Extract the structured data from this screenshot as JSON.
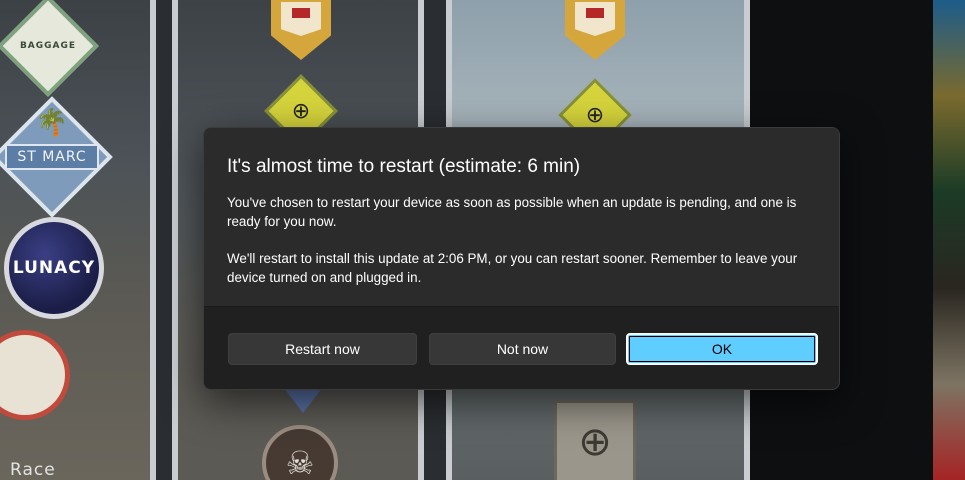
{
  "background": {
    "badges": {
      "baggage": "BAGGAGE",
      "st_marc": "ST MARC",
      "lunacy": "LUNACY",
      "race": "Race"
    }
  },
  "dialog": {
    "title": "It's almost time to restart (estimate: 6 min)",
    "paragraph1": "You've chosen to restart your device as soon as possible when an update is pending, and one is ready for you now.",
    "paragraph2": "We'll restart to install this update at 2:06 PM, or you can restart sooner. Remember to leave your device turned on and plugged in.",
    "buttons": {
      "restart_now": "Restart now",
      "not_now": "Not now",
      "ok": "OK"
    },
    "accent_color": "#60cdff"
  }
}
